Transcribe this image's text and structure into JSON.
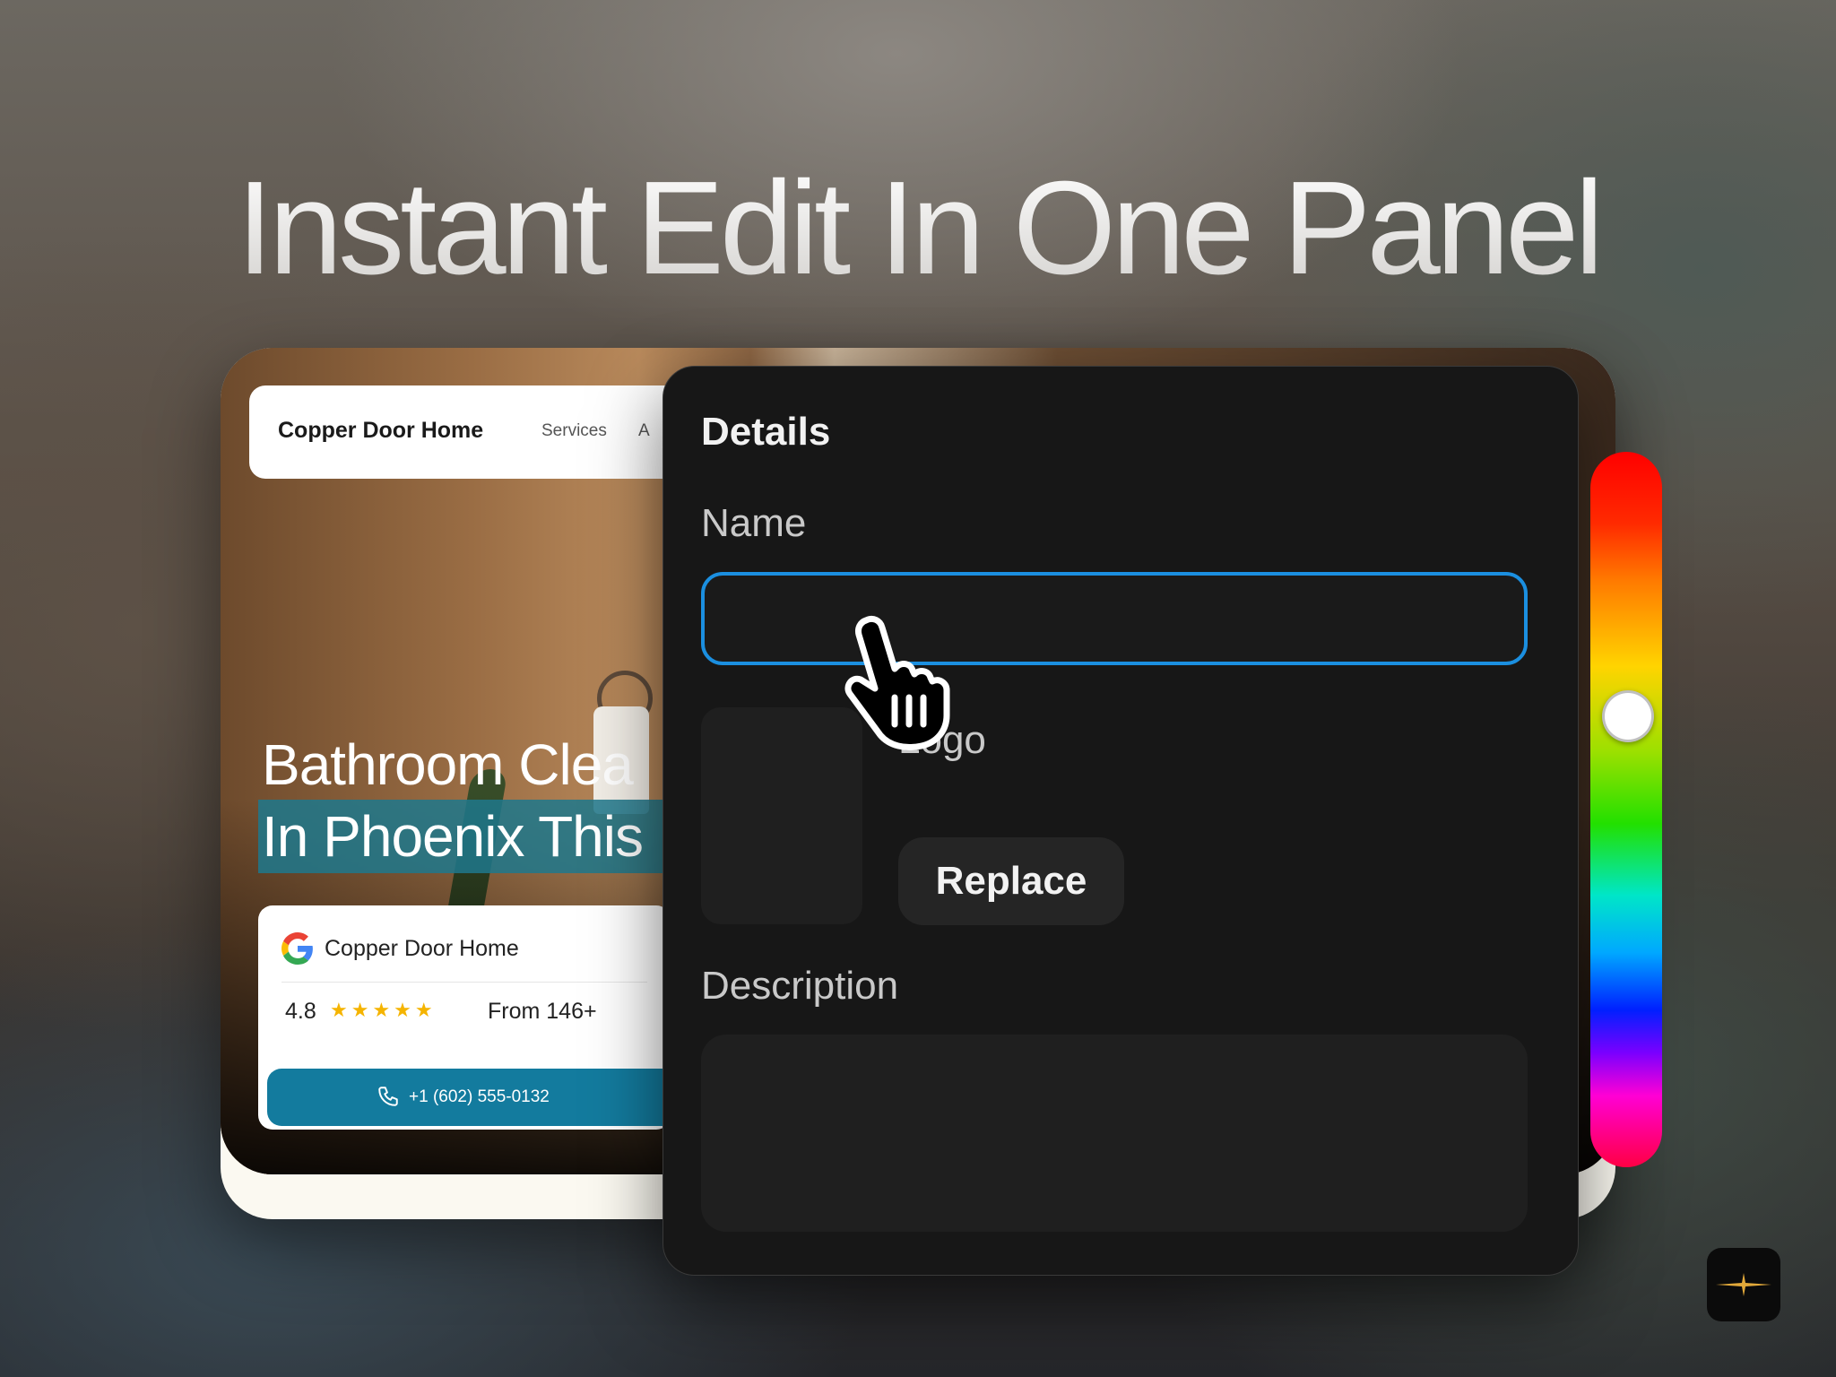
{
  "headline": "Instant Edit In One Panel",
  "website": {
    "brand": "Copper Door Home",
    "nav": [
      "Services",
      "A"
    ],
    "hero_line1": "Bathroom Clea",
    "hero_line2": "In Phoenix This",
    "review": {
      "name": "Copper Door Home",
      "rating": "4.8",
      "stars": "★★★★★",
      "from": "From 146+"
    },
    "call_button": "+1 (602) 555-0132"
  },
  "panel": {
    "title": "Details",
    "name_label": "Name",
    "name_value": "",
    "logo_label": "Logo",
    "replace_button": "Replace",
    "description_label": "Description",
    "description_value": ""
  },
  "colors": {
    "accent_blue": "#1b8fe0",
    "call_button": "#137b9e",
    "panel_bg": "#171717",
    "star": "#f5b400"
  },
  "icons": {
    "google": "google-logo-icon",
    "phone": "phone-icon",
    "cursor": "hand-pointer-icon",
    "sparkle": "sparkle-icon"
  },
  "hue_slider_position": 0.36
}
